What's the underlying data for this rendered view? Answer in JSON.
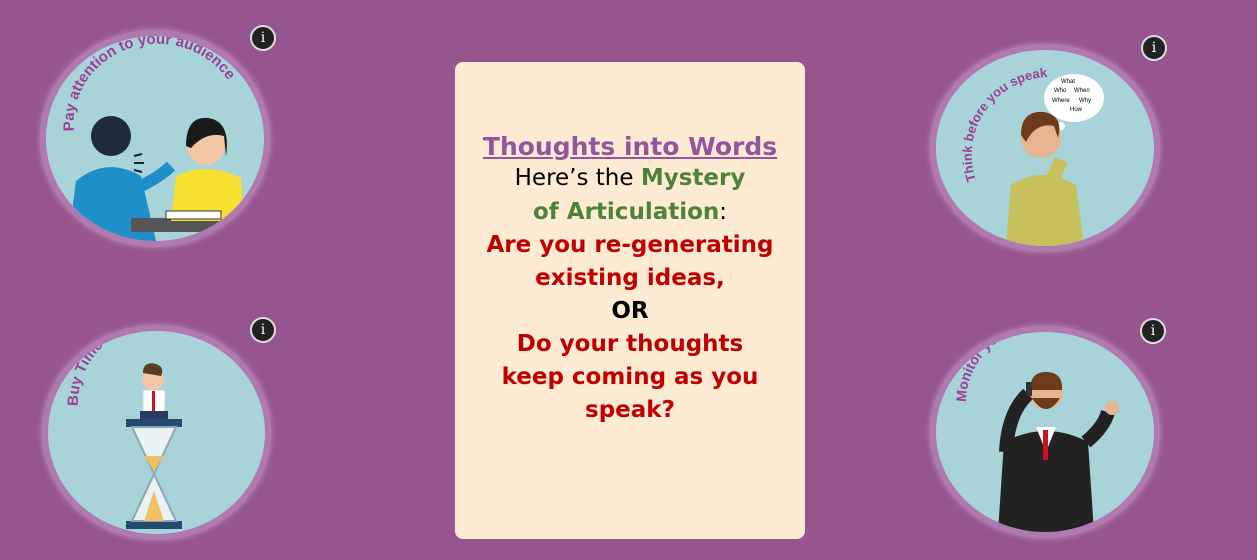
{
  "card": {
    "title": "Thoughts into Words",
    "intro_prefix": "Here’s the ",
    "intro_highlight": "Mystery of Articulation",
    "intro_suffix": ":",
    "question_1": "Are you re-generating existing ideas,",
    "or_text": "OR",
    "question_2": "Do your thoughts keep coming as you speak?",
    "colors": {
      "background": "#fdebd3",
      "title": "#95549d",
      "highlight": "#4e8238",
      "question": "#c00000"
    }
  },
  "tips": [
    {
      "label": "Pay attention to your audience",
      "info_icon": "info-icon"
    },
    {
      "label": "Think before you speak",
      "info_icon": "info-icon",
      "bubble_words": [
        "What",
        "Who",
        "When",
        "Where",
        "Why",
        "How"
      ]
    },
    {
      "label": "Buy Time to Design Thoughts",
      "info_icon": "info-icon"
    },
    {
      "label": "Monitor your Delivery speed",
      "info_icon": "info-icon"
    }
  ],
  "info_glyph": "i",
  "colors": {
    "page_background": "#97558f",
    "circle_fill": "#a8d3d9",
    "circle_text": "#9b3f96"
  }
}
